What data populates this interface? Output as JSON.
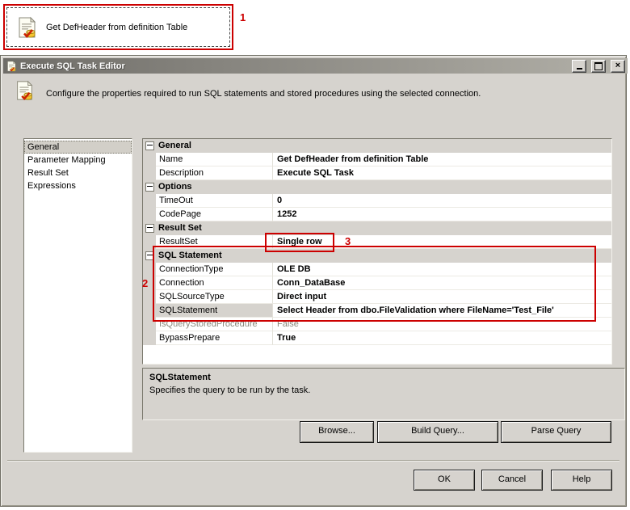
{
  "annotations": {
    "one": "1",
    "two": "2",
    "three": "3",
    "color": "#cc0000"
  },
  "task": {
    "label": "Get DefHeader from definition Table"
  },
  "dialog": {
    "title": "Execute SQL Task Editor",
    "header_text": "Configure the properties required to run SQL statements and stored procedures using the selected connection.",
    "colors": {
      "dialog_bg": "#d6d3ce"
    },
    "sidebar": {
      "items": [
        {
          "label": "General"
        },
        {
          "label": "Parameter Mapping"
        },
        {
          "label": "Result Set"
        },
        {
          "label": "Expressions"
        }
      ]
    },
    "grid": {
      "sections": [
        {
          "header": "General",
          "rows": [
            {
              "name": "Name",
              "value": "Get DefHeader from definition Table"
            },
            {
              "name": "Description",
              "value": "Execute SQL Task"
            }
          ]
        },
        {
          "header": "Options",
          "rows": [
            {
              "name": "TimeOut",
              "value": "0"
            },
            {
              "name": "CodePage",
              "value": "1252"
            }
          ]
        },
        {
          "header": "Result Set",
          "rows": [
            {
              "name": "ResultSet",
              "value": "Single row"
            }
          ]
        },
        {
          "header": "SQL Statement",
          "rows": [
            {
              "name": "ConnectionType",
              "value": "OLE DB"
            },
            {
              "name": "Connection",
              "value": "Conn_DataBase"
            },
            {
              "name": "SQLSourceType",
              "value": "Direct input"
            },
            {
              "name": "SQLStatement",
              "value": "Select Header from dbo.FileValidation where FileName='Test_File'"
            },
            {
              "name": "IsQueryStoredProcedure",
              "value": "False"
            },
            {
              "name": "BypassPrepare",
              "value": "True"
            }
          ]
        }
      ]
    },
    "help": {
      "title": "SQLStatement",
      "text": "Specifies the query to be run by the task."
    },
    "buttons": {
      "browse": "Browse...",
      "build_query": "Build Query...",
      "parse_query": "Parse Query",
      "ok": "OK",
      "cancel": "Cancel",
      "help": "Help"
    }
  }
}
